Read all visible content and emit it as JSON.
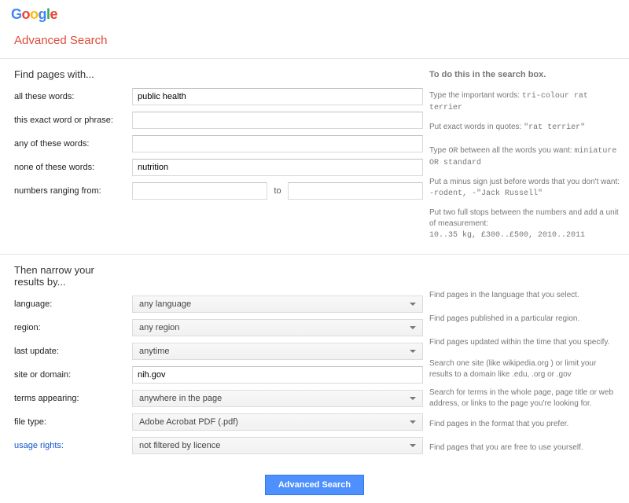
{
  "logo": {
    "g1": "G",
    "o1": "o",
    "o2": "o",
    "g2": "g",
    "l": "l",
    "e": "e"
  },
  "title": "Advanced Search",
  "find": {
    "heading": "Find pages with...",
    "help_heading": "To do this in the search box.",
    "rows": {
      "all_words": {
        "label": "all these words:",
        "value": "public health"
      },
      "exact": {
        "label": "this exact word or phrase:",
        "value": ""
      },
      "any": {
        "label": "any of these words:",
        "value": ""
      },
      "none": {
        "label": "none of these words:",
        "value": "nutrition"
      },
      "range": {
        "label": "numbers ranging from:",
        "from": "",
        "to_label": "to",
        "to": ""
      }
    },
    "tips": {
      "all_words": {
        "pre": "Type the important words: ",
        "code": "tri-colour rat terrier"
      },
      "exact": {
        "pre": "Put exact words in quotes: ",
        "code": "\"rat terrier\""
      },
      "any": {
        "pre": "Type ",
        "mid1": "OR",
        "mid2": " between all the words you want: ",
        "code": "miniature OR standard"
      },
      "none": {
        "line1": "Put a minus sign just before words that you don't want:",
        "code": "-rodent, -\"Jack Russell\""
      },
      "range": {
        "line1": "Put two full stops between the numbers and add a unit of measurement:",
        "code": "10..35 kg, £300..£500, 2010..2011"
      }
    }
  },
  "narrow": {
    "heading": "Then narrow your results by...",
    "rows": {
      "language": {
        "label": "language:",
        "value": "any language"
      },
      "region": {
        "label": "region:",
        "value": "any region"
      },
      "last_update": {
        "label": "last update:",
        "value": "anytime"
      },
      "site": {
        "label": "site or domain:",
        "value": "nih.gov"
      },
      "terms": {
        "label": "terms appearing:",
        "value": "anywhere in the page"
      },
      "filetype": {
        "label": "file type:",
        "value": "Adobe Acrobat PDF (.pdf)"
      },
      "rights": {
        "label": "usage rights:",
        "value": "not filtered by licence"
      }
    },
    "tips": {
      "language": "Find pages in the language that you select.",
      "region": "Find pages published in a particular region.",
      "last_update": "Find pages updated within the time that you specify.",
      "site": {
        "pre": "Search one site (like ",
        "code1": "wikipedia.org",
        "mid": " ) or limit your results to a domain like ",
        "code2": ".edu",
        "sep1": ", ",
        "code3": ".org",
        "sep2": " or ",
        "code4": ".gov"
      },
      "terms": "Search for terms in the whole page, page title or web address, or links to the page you're looking for.",
      "filetype": "Find pages in the format that you prefer.",
      "rights": "Find pages that you are free to use yourself."
    }
  },
  "button": "Advanced Search"
}
